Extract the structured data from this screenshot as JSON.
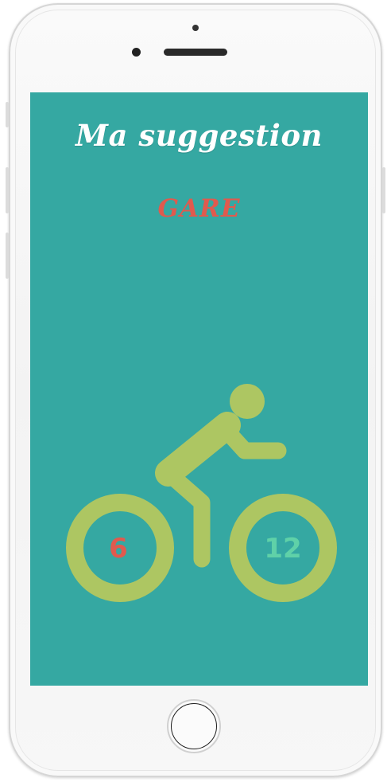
{
  "screen": {
    "title": "Ma suggestion",
    "destination": "GARE",
    "background_color": "#35a8a2"
  },
  "bike": {
    "icon": "cyclist-icon",
    "color": "#adc662",
    "left_wheel_value": "6",
    "left_wheel_color": "#e05a4e",
    "right_wheel_value": "12",
    "right_wheel_color": "#5fd1a8"
  },
  "device": {
    "home_button_icon": "home-button-icon",
    "camera_icon": "front-camera-icon"
  }
}
